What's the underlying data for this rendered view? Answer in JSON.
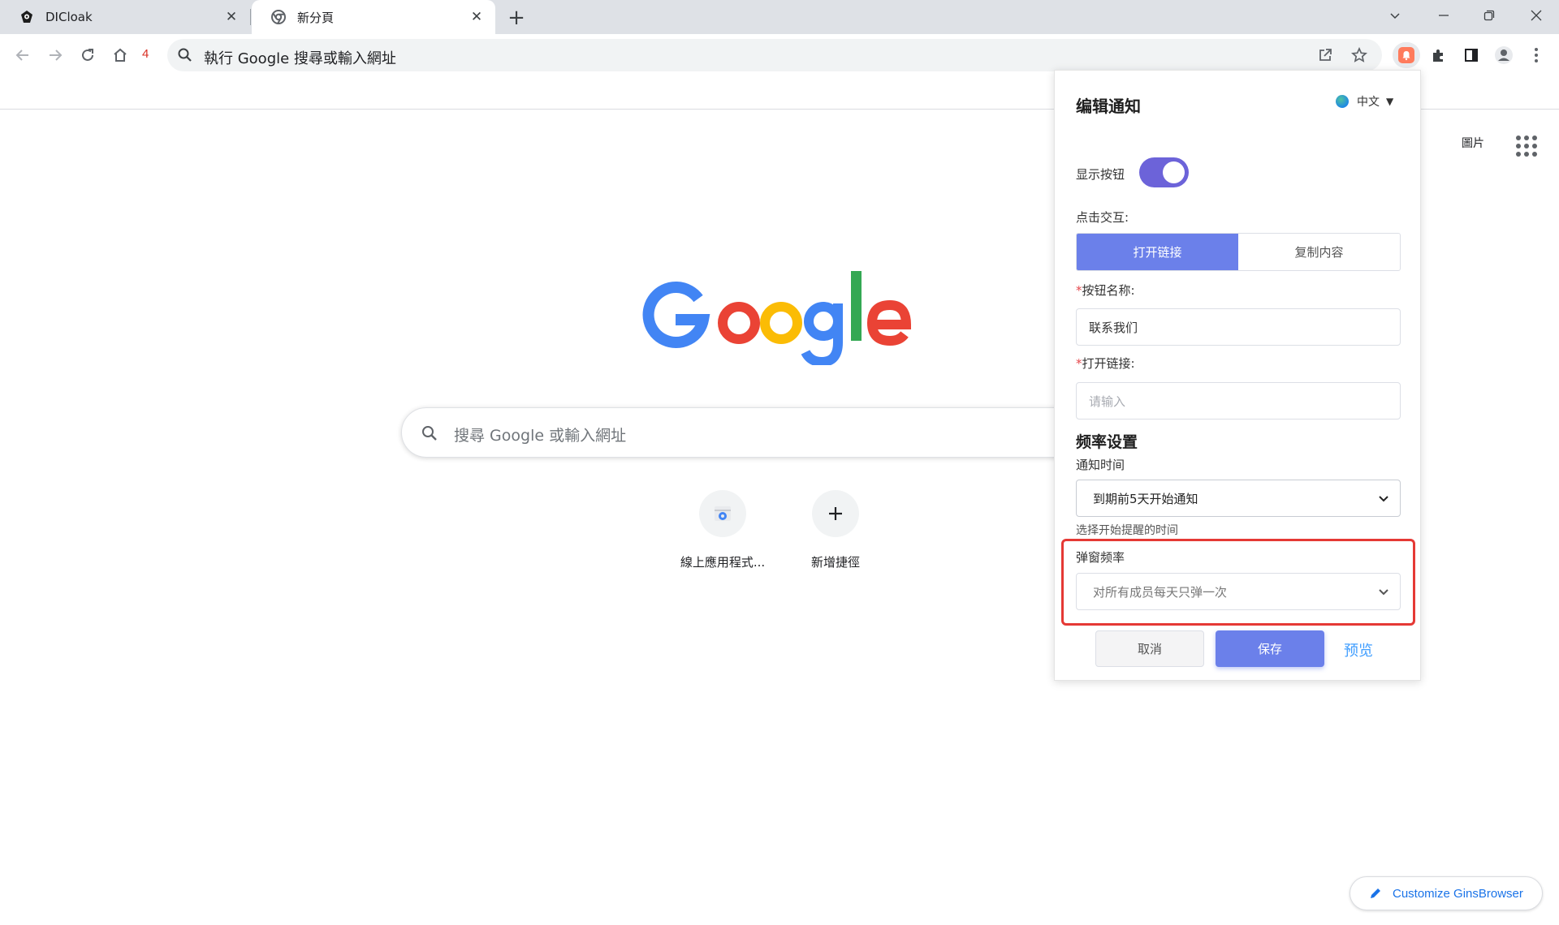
{
  "tabs": [
    {
      "title": "DICloak",
      "active": false,
      "close": "✕"
    },
    {
      "title": "新分頁",
      "active": true,
      "close": "✕"
    }
  ],
  "window_controls": [
    "chevron-down",
    "minimize",
    "restore",
    "close"
  ],
  "toolbar": {
    "count_badge": "4",
    "omnibox_text": "執行 Google 搜尋或輸入網址"
  },
  "ntp": {
    "images_link": "圖片",
    "search_placeholder": "搜尋 Google 或輸入網址",
    "shortcuts": [
      {
        "label": "線上應用程式..."
      },
      {
        "label": "新增捷徑"
      }
    ],
    "customize_label": "Customize GinsBrowser"
  },
  "popup": {
    "title": "编辑通知",
    "language": "中文",
    "show_button_label": "显示按钮",
    "show_button_on": true,
    "click_interaction_label": "点击交互:",
    "segments": [
      {
        "label": "打开链接",
        "selected": true
      },
      {
        "label": "复制内容",
        "selected": false
      }
    ],
    "required_mark": "*",
    "button_name_label": "按钮名称:",
    "button_name_value": "联系我们",
    "open_link_label": "打开链接:",
    "open_link_placeholder": "请输入",
    "frequency_section": "频率设置",
    "notify_time_label": "通知时间",
    "notify_time_value": "到期前5天开始通知",
    "notify_time_hint": "选择开始提醒的时间",
    "popup_frequency_label": "弹窗频率",
    "popup_frequency_value": "对所有成员每天只弹一次",
    "cancel_label": "取消",
    "save_label": "保存",
    "preview_label": "预览"
  },
  "colors": {
    "accent": "#6b80ea",
    "toggle": "#6c63d9",
    "highlight": "#e53935",
    "link": "#409eff"
  }
}
